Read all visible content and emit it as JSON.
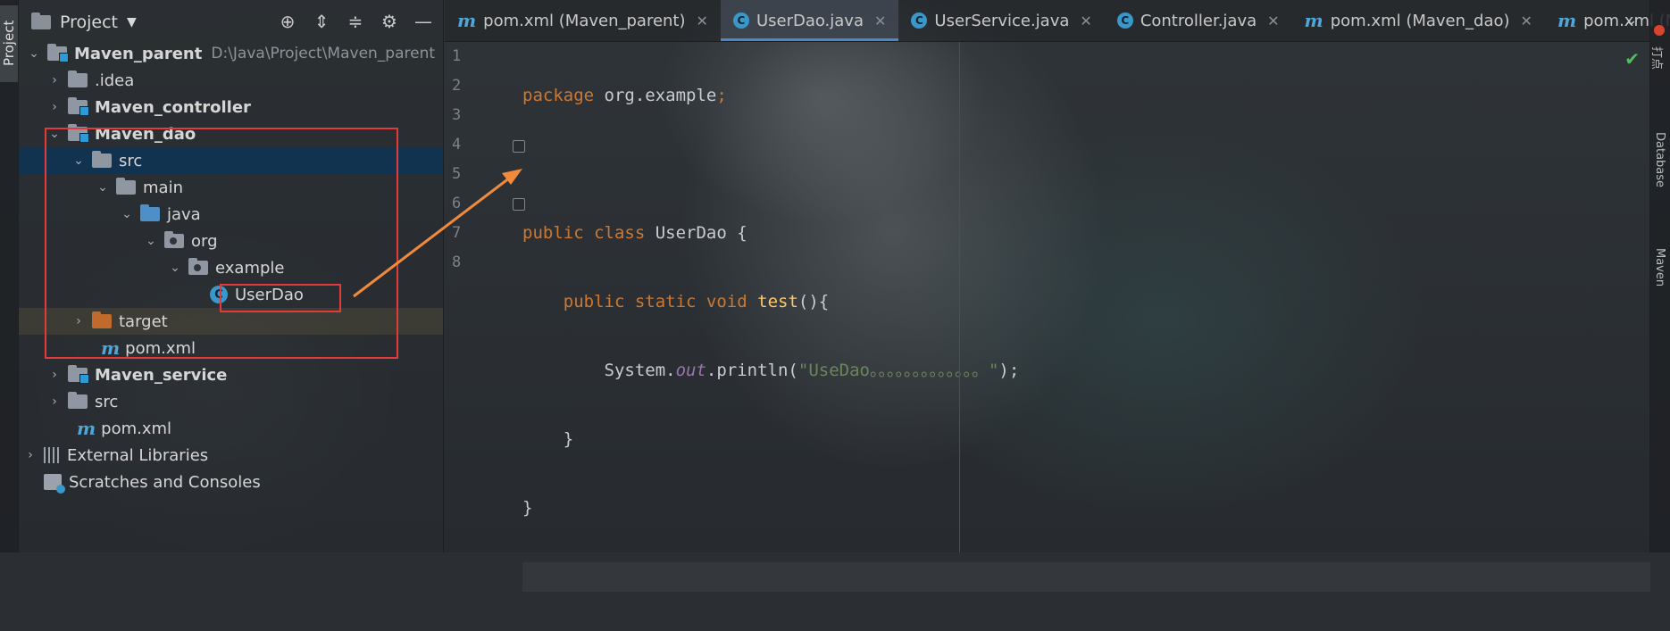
{
  "app": {
    "accent": "#4a88c7",
    "selection": "#0e3455",
    "annotation": "#e23b3b"
  },
  "left_strip": {
    "label": "Project"
  },
  "right_strip": {
    "labels": [
      "打点",
      "Database",
      "Maven"
    ]
  },
  "project_panel": {
    "title": "Project",
    "icons": [
      "locate-icon",
      "expand-all-icon",
      "collapse-all-icon",
      "gear-icon",
      "minimize-icon"
    ],
    "tree": [
      {
        "label": "Maven_parent",
        "path": "D:\\Java\\Project\\Maven_parent"
      },
      {
        "label": ".idea"
      },
      {
        "label": "Maven_controller"
      },
      {
        "label": "Maven_dao"
      },
      {
        "label": "src"
      },
      {
        "label": "main"
      },
      {
        "label": "java"
      },
      {
        "label": "org"
      },
      {
        "label": "example"
      },
      {
        "label": "UserDao"
      },
      {
        "label": "target"
      },
      {
        "label": "pom.xml"
      },
      {
        "label": "Maven_service"
      },
      {
        "label": "src"
      },
      {
        "label": "pom.xml"
      },
      {
        "label": "External Libraries"
      },
      {
        "label": "Scratches and Consoles"
      }
    ]
  },
  "tabs": [
    {
      "label": "pom.xml (Maven_parent)",
      "icon": "maven-icon",
      "glyph": "m"
    },
    {
      "label": "UserDao.java",
      "icon": "class-icon",
      "glyph": "C"
    },
    {
      "label": "UserService.java",
      "icon": "class-icon",
      "glyph": "C"
    },
    {
      "label": "Controller.java",
      "icon": "class-icon",
      "glyph": "C"
    },
    {
      "label": "pom.xml (Maven_dao)",
      "icon": "maven-icon",
      "glyph": "m"
    },
    {
      "label": "pom.xml (Ma",
      "icon": "maven-icon",
      "glyph": "m"
    }
  ],
  "editor": {
    "line_numbers": [
      "1",
      "2",
      "3",
      "4",
      "5",
      "6",
      "7",
      "8"
    ],
    "code": {
      "l1_kw": "package",
      "l1_rest": " org.example",
      "l1_semi": ";",
      "l3_kw": "public class",
      "l3_rest": " UserDao {",
      "l4_indent": "    ",
      "l4_kw": "public static void",
      "l4_sp": " ",
      "l4_fn": "test",
      "l4_rest": "(){",
      "l5_indent": "        ",
      "l5_a": "System.",
      "l5_it": "out",
      "l5_b": ".println(",
      "l5_str": "\"UseDao。。。。。。。。。。。。。\"",
      "l5_c": ");",
      "l6": "    }",
      "l7": "}"
    }
  }
}
